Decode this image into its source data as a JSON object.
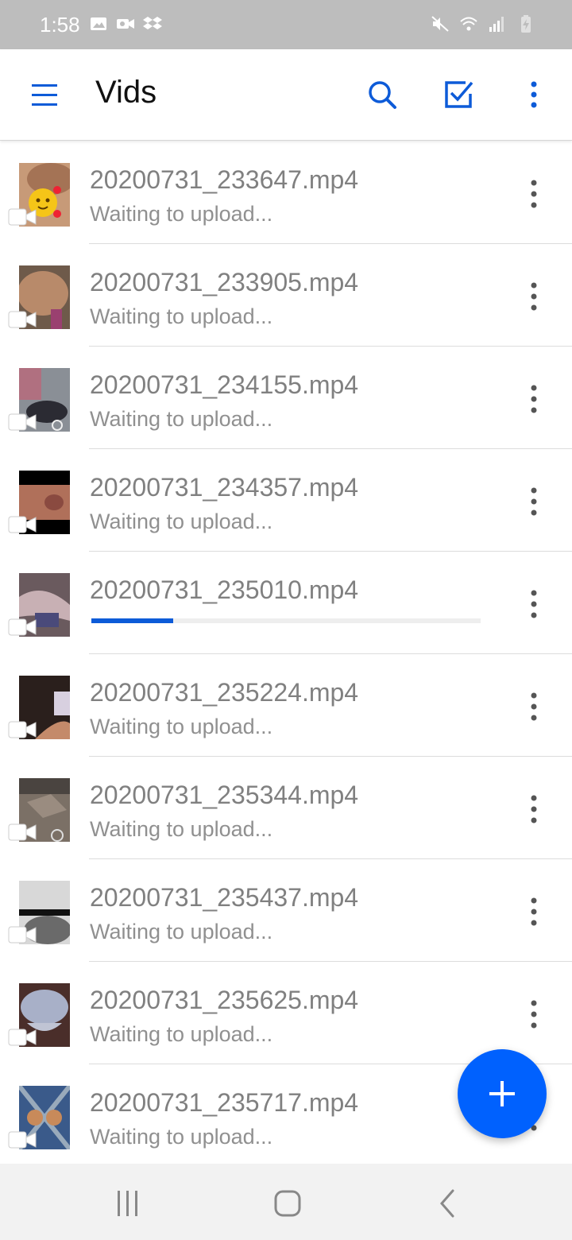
{
  "status_bar": {
    "time": "1:58",
    "left_icons": [
      "image-icon",
      "video-camera-icon",
      "dropbox-icon"
    ],
    "right_icons": [
      "mute-icon",
      "wifi-icon",
      "signal-icon",
      "battery-charging-icon"
    ]
  },
  "app_bar": {
    "title": "Vids",
    "icons": [
      "menu-icon",
      "search-icon",
      "select-checkbox-icon",
      "more-vert-icon"
    ]
  },
  "colors": {
    "accent": "#0061fe",
    "progress": "#0d5bd8",
    "file_text": "#808080",
    "status_bar_bg": "#bdbdbd"
  },
  "files": [
    {
      "name": "20200731_233647.mp4",
      "status": "Waiting to upload...",
      "thumb": "thumb-1"
    },
    {
      "name": "20200731_233905.mp4",
      "status": "Waiting to upload...",
      "thumb": "thumb-2"
    },
    {
      "name": "20200731_234155.mp4",
      "status": "Waiting to upload...",
      "thumb": "thumb-3"
    },
    {
      "name": "20200731_234357.mp4",
      "status": "Waiting to upload...",
      "thumb": "thumb-4"
    },
    {
      "name": "20200731_235010.mp4",
      "status": "",
      "uploading": true,
      "progress": 0.21,
      "thumb": "thumb-5"
    },
    {
      "name": "20200731_235224.mp4",
      "status": "Waiting to upload...",
      "thumb": "thumb-6"
    },
    {
      "name": "20200731_235344.mp4",
      "status": "Waiting to upload...",
      "thumb": "thumb-7"
    },
    {
      "name": "20200731_235437.mp4",
      "status": "Waiting to upload...",
      "thumb": "thumb-8"
    },
    {
      "name": "20200731_235625.mp4",
      "status": "Waiting to upload...",
      "thumb": "thumb-9"
    },
    {
      "name": "20200731_235717.mp4",
      "status": "Waiting to upload...",
      "thumb": "thumb-10"
    }
  ],
  "fab": {
    "icon": "plus-icon"
  },
  "nav_bar": {
    "icons": [
      "recent-apps-icon",
      "home-icon",
      "back-icon"
    ]
  }
}
